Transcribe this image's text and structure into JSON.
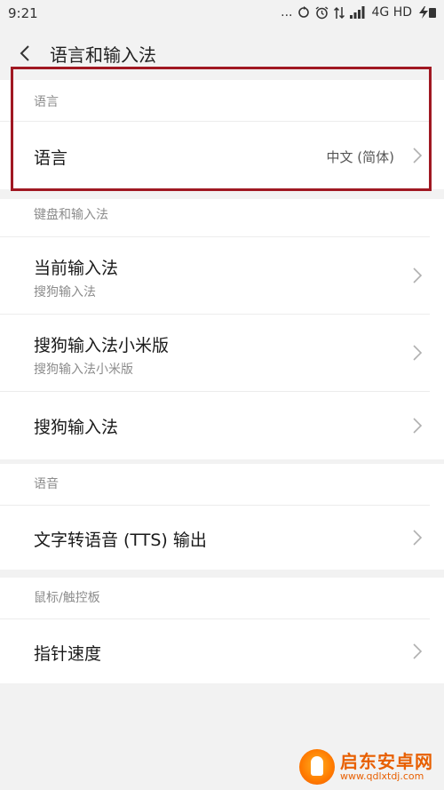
{
  "status_bar": {
    "time": "9:21",
    "more": "...",
    "network": "4G HD"
  },
  "header": {
    "title": "语言和输入法"
  },
  "sections": {
    "language": {
      "header": "语言",
      "rows": [
        {
          "label": "语言",
          "value": "中文 (简体)"
        }
      ]
    },
    "keyboard": {
      "header": "键盘和输入法",
      "rows": [
        {
          "label": "当前输入法",
          "sub": "搜狗输入法"
        },
        {
          "label": "搜狗输入法小米版",
          "sub": "搜狗输入法小米版"
        },
        {
          "label": "搜狗输入法"
        }
      ]
    },
    "speech": {
      "header": "语音",
      "rows": [
        {
          "label": "文字转语音 (TTS) 输出"
        }
      ]
    },
    "mouse": {
      "header": "鼠标/触控板",
      "rows": [
        {
          "label": "指针速度"
        }
      ]
    }
  },
  "highlight_color": "#a01822",
  "watermark": {
    "title": "启东安卓网",
    "url": "www.qdlxtdj.com"
  }
}
